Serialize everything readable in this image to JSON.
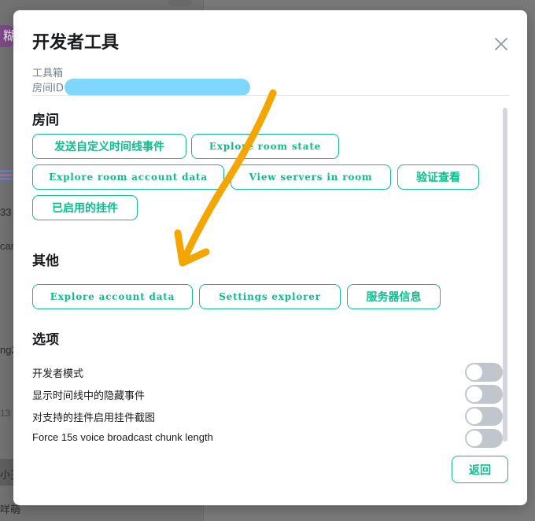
{
  "dialog": {
    "title": "开发者工具",
    "toolbox_label": "工具箱",
    "room_id_label": "房间ID"
  },
  "sections": {
    "room": {
      "heading": "房间",
      "buttons": [
        "发送自定义时间线事件",
        "Explore room state",
        "Explore room account data",
        "View servers in room",
        "验证查看",
        "已启用的挂件"
      ]
    },
    "other": {
      "heading": "其他",
      "buttons": [
        "Explore account data",
        "Settings explorer",
        "服务器信息"
      ]
    },
    "options": {
      "heading": "选项",
      "toggles": [
        {
          "label": "开发者模式",
          "on": false
        },
        {
          "label": "显示时间线中的隐藏事件",
          "on": false
        },
        {
          "label": "对支持的挂件启用挂件截图",
          "on": false
        },
        {
          "label": "Force 15s voice broadcast chunk length",
          "on": false
        }
      ]
    }
  },
  "footer": {
    "back_label": "返回"
  },
  "background": {
    "avatar_char": "糊",
    "fragments": [
      "33",
      "can",
      "ng2",
      "13",
      "小丑",
      "咩萌"
    ]
  },
  "colors": {
    "accent": "#0dbd8b",
    "toggle_off": "#c1c6cd",
    "redaction": "#7fd6ff",
    "annotation_arrow": "#f5a500"
  },
  "icons": {
    "close": "close-icon",
    "annotation": "arrow-annotation-icon"
  }
}
